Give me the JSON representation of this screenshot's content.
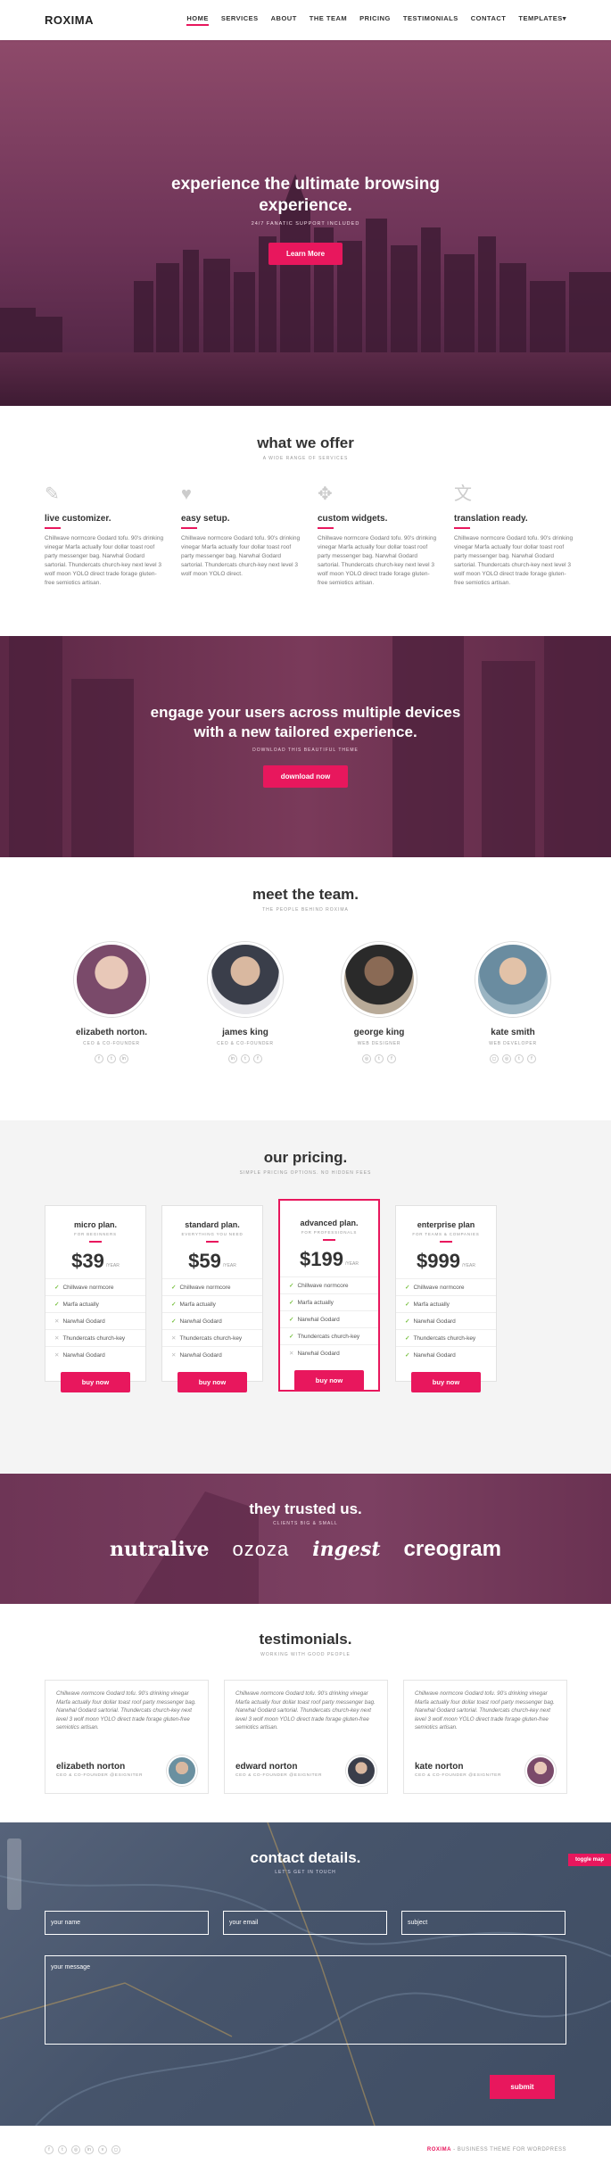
{
  "nav": {
    "logo": "ROXIMA",
    "items": [
      "HOME",
      "SERVICES",
      "ABOUT",
      "THE TEAM",
      "PRICING",
      "TESTIMONIALS",
      "CONTACT",
      "TEMPLATES"
    ]
  },
  "hero": {
    "title_line1": "experience the ultimate browsing",
    "title_line2": "experience.",
    "subtitle": "24/7 FANATIC SUPPORT INCLUDED",
    "button": "Learn More"
  },
  "offer": {
    "title": "what we offer",
    "subtitle": "A WIDE RANGE OF SERVICES",
    "features": [
      {
        "icon": "edit-icon",
        "title": "live customizer.",
        "text": "Chillwave normcore Godard tofu. 90's drinking vinegar Marfa actually four dollar toast roof party messenger bag. Narwhal Godard sartorial. Thundercats church-key next level 3 wolf moon YOLO direct trade forage gluten-free semiotics artisan."
      },
      {
        "icon": "heart-icon",
        "title": "easy setup.",
        "text": "Chillwave normcore Godard tofu. 90's drinking vinegar Marfa actually four dollar toast roof party messenger bag. Narwhal Godard sartorial. Thundercats church-key next level 3 wolf moon YOLO direct."
      },
      {
        "icon": "move-icon",
        "title": "custom widgets.",
        "text": "Chillwave normcore Godard tofu. 90's drinking vinegar Marfa actually four dollar toast roof party messenger bag. Narwhal Godard sartorial. Thundercats church-key next level 3 wolf moon YOLO direct trade forage gluten-free semiotics artisan."
      },
      {
        "icon": "translate-icon",
        "title": "translation ready.",
        "text": "Chillwave normcore Godard tofu. 90's drinking vinegar Marfa actually four dollar toast roof party messenger bag. Narwhal Godard sartorial. Thundercats church-key next level 3 wolf moon YOLO direct trade forage gluten-free semiotics artisan."
      }
    ]
  },
  "engage": {
    "title_line1": "engage your users across multiple devices",
    "title_line2": "with a new tailored experience.",
    "subtitle": "DOWNLOAD THIS BEAUTIFUL THEME",
    "button": "download now"
  },
  "team": {
    "title": "meet the team.",
    "subtitle": "THE PEOPLE BEHIND ROXIMA",
    "members": [
      {
        "name": "elizabeth norton.",
        "role": "CEO & CO-FOUNDER",
        "color": "#7a4a6a"
      },
      {
        "name": "james king",
        "role": "CEO & CO-FOUNDER",
        "color": "#5a5e6a"
      },
      {
        "name": "george king",
        "role": "WEB DESIGNER",
        "color": "#6b5a4a"
      },
      {
        "name": "kate smith",
        "role": "WEB DEVELOPER",
        "color": "#7a98a8"
      }
    ]
  },
  "pricing": {
    "title": "our pricing.",
    "subtitle": "SIMPLE PRICING OPTIONS. NO HIDDEN FEES",
    "year_label": "/YEAR",
    "plans": [
      {
        "name": "micro plan.",
        "for": "FOR BEGINNERS",
        "price": "$39",
        "features": [
          [
            "Chillwave normcore",
            true
          ],
          [
            "Marfa actually",
            true
          ],
          [
            "Narwhal Godard",
            false
          ],
          [
            "Thundercats church-key",
            false
          ],
          [
            "Narwhal Godard",
            false
          ]
        ],
        "button": "buy now"
      },
      {
        "name": "standard plan.",
        "for": "EVERYTHING YOU NEED",
        "price": "$59",
        "features": [
          [
            "Chillwave normcore",
            true
          ],
          [
            "Marfa actually",
            true
          ],
          [
            "Narwhal Godard",
            true
          ],
          [
            "Thundercats church-key",
            false
          ],
          [
            "Narwhal Godard",
            false
          ]
        ],
        "button": "buy now"
      },
      {
        "name": "advanced plan.",
        "for": "FOR PROFESSIONALS",
        "price": "$199",
        "features": [
          [
            "Chillwave normcore",
            true
          ],
          [
            "Marfa actually",
            true
          ],
          [
            "Narwhal Godard",
            true
          ],
          [
            "Thundercats church-key",
            true
          ],
          [
            "Narwhal Godard",
            false
          ]
        ],
        "button": "buy now"
      },
      {
        "name": "enterprise plan",
        "for": "FOR TEAMS & COMPANIES",
        "price": "$999",
        "features": [
          [
            "Chillwave normcore",
            true
          ],
          [
            "Marfa actually",
            true
          ],
          [
            "Narwhal Godard",
            true
          ],
          [
            "Thundercats church-key",
            true
          ],
          [
            "Narwhal Godard",
            true
          ]
        ],
        "button": "buy now"
      }
    ]
  },
  "trusted": {
    "title": "they trusted us.",
    "subtitle": "CLIENTS BIG & SMALL",
    "logos": [
      "nutralive",
      "ozoza",
      "ingest",
      "creogram"
    ]
  },
  "testimonials": {
    "title": "testimonials.",
    "subtitle": "WORKING WITH GOOD PEOPLE",
    "items": [
      {
        "text": "Chillwave normcore Godard tofu. 90's drinking vinegar Marfa actually four dollar toast roof party messenger bag. Narwhal Godard sartorial. Thundercats church-key next level 3 wolf moon YOLO direct trade forage gluten-free semiotics artisan.",
        "name": "elizabeth norton",
        "role": "CEO & CO-FOUNDER @ESIGNITER",
        "color": "#6a90a0"
      },
      {
        "text": "Chillwave normcore Godard tofu. 90's drinking vinegar Marfa actually four dollar toast roof party messenger bag. Narwhal Godard sartorial. Thundercats church-key next level 3 wolf moon YOLO direct trade forage gluten-free semiotics artisan.",
        "name": "edward norton",
        "role": "CEO & CO-FOUNDER @ESIGNITER",
        "color": "#5a5e6a"
      },
      {
        "text": "Chillwave normcore Godard tofu. 90's drinking vinegar Marfa actually four dollar toast roof party messenger bag. Narwhal Godard sartorial. Thundercats church-key next level 3 wolf moon YOLO direct trade forage gluten-free semiotics artisan.",
        "name": "kate norton",
        "role": "CEO & CO-FOUNDER @ESIGNITER",
        "color": "#7a4a6a"
      }
    ]
  },
  "contact": {
    "title": "contact details.",
    "subtitle": "LET'S GET IN TOUCH",
    "toggle": "toggle map",
    "name_placeholder": "your name",
    "email_placeholder": "your email",
    "subject_placeholder": "subject",
    "message_placeholder": "your message",
    "submit": "submit"
  },
  "footer": {
    "brand": "ROXIMA",
    "tagline": " - BUSINESS THEME FOR WORDPRESS"
  },
  "colors": {
    "accent": "#e8175d",
    "hero": "#7a3a5c",
    "contact": "#4a5870"
  }
}
